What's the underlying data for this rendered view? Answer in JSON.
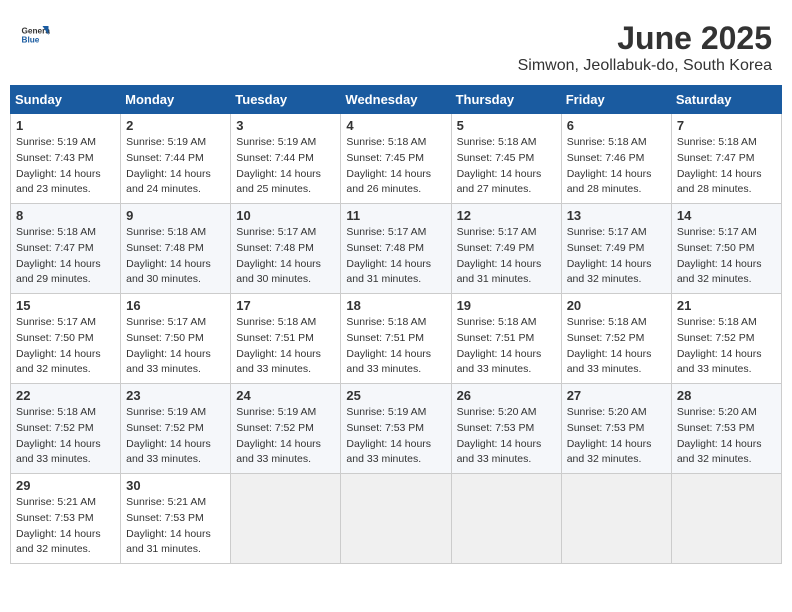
{
  "header": {
    "logo_general": "General",
    "logo_blue": "Blue",
    "title": "June 2025",
    "subtitle": "Simwon, Jeollabuk-do, South Korea"
  },
  "calendar": {
    "days_of_week": [
      "Sunday",
      "Monday",
      "Tuesday",
      "Wednesday",
      "Thursday",
      "Friday",
      "Saturday"
    ],
    "weeks": [
      [
        null,
        {
          "day": "2",
          "sunrise": "5:19 AM",
          "sunset": "7:44 PM",
          "daylight": "14 hours and 24 minutes."
        },
        {
          "day": "3",
          "sunrise": "5:19 AM",
          "sunset": "7:44 PM",
          "daylight": "14 hours and 25 minutes."
        },
        {
          "day": "4",
          "sunrise": "5:18 AM",
          "sunset": "7:45 PM",
          "daylight": "14 hours and 26 minutes."
        },
        {
          "day": "5",
          "sunrise": "5:18 AM",
          "sunset": "7:45 PM",
          "daylight": "14 hours and 27 minutes."
        },
        {
          "day": "6",
          "sunrise": "5:18 AM",
          "sunset": "7:46 PM",
          "daylight": "14 hours and 28 minutes."
        },
        {
          "day": "7",
          "sunrise": "5:18 AM",
          "sunset": "7:47 PM",
          "daylight": "14 hours and 28 minutes."
        }
      ],
      [
        {
          "day": "1",
          "sunrise": "5:19 AM",
          "sunset": "7:43 PM",
          "daylight": "14 hours and 23 minutes."
        },
        {
          "day": "9",
          "sunrise": "5:18 AM",
          "sunset": "7:48 PM",
          "daylight": "14 hours and 30 minutes."
        },
        {
          "day": "10",
          "sunrise": "5:17 AM",
          "sunset": "7:48 PM",
          "daylight": "14 hours and 30 minutes."
        },
        {
          "day": "11",
          "sunrise": "5:17 AM",
          "sunset": "7:48 PM",
          "daylight": "14 hours and 31 minutes."
        },
        {
          "day": "12",
          "sunrise": "5:17 AM",
          "sunset": "7:49 PM",
          "daylight": "14 hours and 31 minutes."
        },
        {
          "day": "13",
          "sunrise": "5:17 AM",
          "sunset": "7:49 PM",
          "daylight": "14 hours and 32 minutes."
        },
        {
          "day": "14",
          "sunrise": "5:17 AM",
          "sunset": "7:50 PM",
          "daylight": "14 hours and 32 minutes."
        }
      ],
      [
        {
          "day": "8",
          "sunrise": "5:18 AM",
          "sunset": "7:47 PM",
          "daylight": "14 hours and 29 minutes."
        },
        {
          "day": "16",
          "sunrise": "5:17 AM",
          "sunset": "7:50 PM",
          "daylight": "14 hours and 33 minutes."
        },
        {
          "day": "17",
          "sunrise": "5:18 AM",
          "sunset": "7:51 PM",
          "daylight": "14 hours and 33 minutes."
        },
        {
          "day": "18",
          "sunrise": "5:18 AM",
          "sunset": "7:51 PM",
          "daylight": "14 hours and 33 minutes."
        },
        {
          "day": "19",
          "sunrise": "5:18 AM",
          "sunset": "7:51 PM",
          "daylight": "14 hours and 33 minutes."
        },
        {
          "day": "20",
          "sunrise": "5:18 AM",
          "sunset": "7:52 PM",
          "daylight": "14 hours and 33 minutes."
        },
        {
          "day": "21",
          "sunrise": "5:18 AM",
          "sunset": "7:52 PM",
          "daylight": "14 hours and 33 minutes."
        }
      ],
      [
        {
          "day": "15",
          "sunrise": "5:17 AM",
          "sunset": "7:50 PM",
          "daylight": "14 hours and 32 minutes."
        },
        {
          "day": "23",
          "sunrise": "5:19 AM",
          "sunset": "7:52 PM",
          "daylight": "14 hours and 33 minutes."
        },
        {
          "day": "24",
          "sunrise": "5:19 AM",
          "sunset": "7:52 PM",
          "daylight": "14 hours and 33 minutes."
        },
        {
          "day": "25",
          "sunrise": "5:19 AM",
          "sunset": "7:53 PM",
          "daylight": "14 hours and 33 minutes."
        },
        {
          "day": "26",
          "sunrise": "5:20 AM",
          "sunset": "7:53 PM",
          "daylight": "14 hours and 33 minutes."
        },
        {
          "day": "27",
          "sunrise": "5:20 AM",
          "sunset": "7:53 PM",
          "daylight": "14 hours and 32 minutes."
        },
        {
          "day": "28",
          "sunrise": "5:20 AM",
          "sunset": "7:53 PM",
          "daylight": "14 hours and 32 minutes."
        }
      ],
      [
        {
          "day": "22",
          "sunrise": "5:18 AM",
          "sunset": "7:52 PM",
          "daylight": "14 hours and 33 minutes."
        },
        {
          "day": "30",
          "sunrise": "5:21 AM",
          "sunset": "7:53 PM",
          "daylight": "14 hours and 31 minutes."
        },
        null,
        null,
        null,
        null,
        null
      ],
      [
        {
          "day": "29",
          "sunrise": "5:21 AM",
          "sunset": "7:53 PM",
          "daylight": "14 hours and 32 minutes."
        },
        null,
        null,
        null,
        null,
        null,
        null
      ]
    ]
  }
}
